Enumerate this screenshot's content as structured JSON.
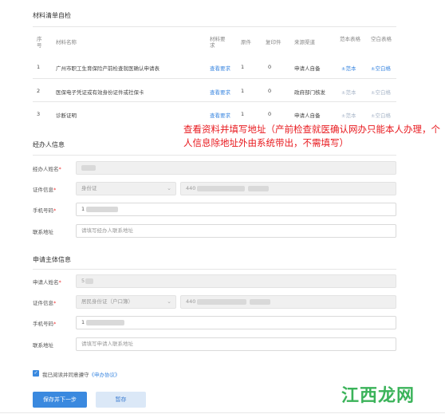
{
  "materials": {
    "title": "材料清单自检",
    "headers": {
      "index": "序号",
      "name": "材料名称",
      "requirement": "材料要求",
      "original": "原件",
      "copies": "复印件",
      "source": "来源渠道",
      "sample": "范本表格",
      "blank": "空白表格"
    },
    "rows": [
      {
        "index": "1",
        "name": "广州市职工生育保险产前检查就医确认申请表",
        "requirement": "查看要求",
        "original": "1",
        "copies": "0",
        "source": "申请人自备",
        "sample": "±范本",
        "blank": "±空白格"
      },
      {
        "index": "2",
        "name": "医保电子凭证或有效身份证件或社保卡",
        "requirement": "查看要求",
        "original": "1",
        "copies": "0",
        "source": "政府部门核发",
        "sample": "±范本",
        "blank": "±空白格"
      },
      {
        "index": "3",
        "name": "诊断证明",
        "requirement": "查看要求",
        "original": "1",
        "copies": "0",
        "source": "申请人自备",
        "sample": "±范本",
        "blank": "±空白格"
      }
    ]
  },
  "annotation": "查看资料并填写地址（产前检查就医确认网办只能本人办理，个人信息除地址外由系统带出，不需填写）",
  "agent": {
    "title": "经办人信息",
    "name_label": "经办人姓名",
    "cert_label": "证件信息",
    "cert_type": "身份证",
    "cert_no_prefix": "440",
    "phone_label": "手机号码",
    "phone_prefix": "1",
    "address_label": "联系地址",
    "address_placeholder": "请填写经办人联系地址"
  },
  "applicant": {
    "title": "申请主体信息",
    "name_label": "申请人姓名",
    "name_prefix": "5",
    "cert_label": "证件信息",
    "cert_type": "居民身份证（户口簿）",
    "cert_no_prefix": "440",
    "phone_label": "手机号码",
    "phone_prefix": "1",
    "address_label": "联系地址",
    "address_placeholder": "请填写申请人联系地址"
  },
  "agreement": {
    "text": "我已阅读并同意遵守",
    "link": "《申办协议》"
  },
  "buttons": {
    "save_next": "保存并下一步",
    "save": "暂存"
  },
  "required_mark": "*",
  "watermark": {
    "main": "江西龙网",
    "sub": "·"
  }
}
